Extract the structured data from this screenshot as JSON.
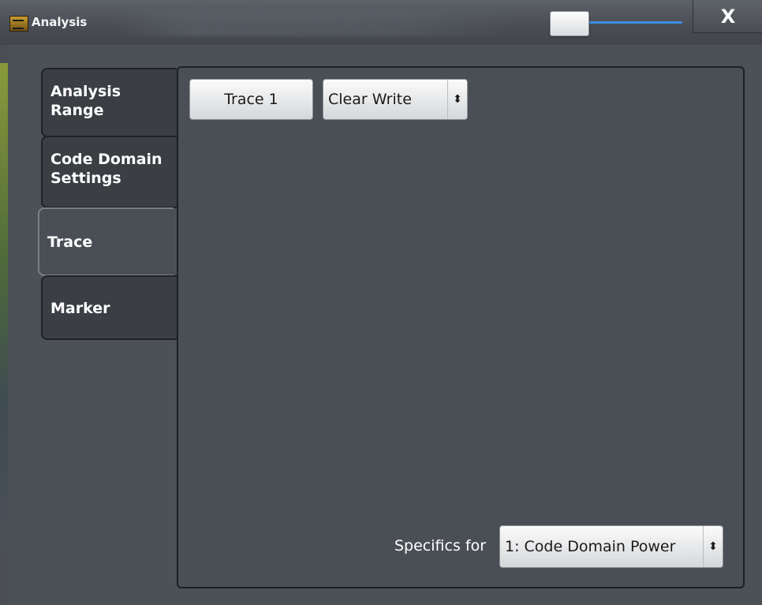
{
  "window": {
    "title": "Analysis",
    "close_label": "X"
  },
  "tabs": [
    {
      "label": "Analysis Range"
    },
    {
      "label": "Code Domain Settings"
    },
    {
      "label": "Trace"
    },
    {
      "label": "Marker"
    }
  ],
  "active_tab": "Trace",
  "trace": {
    "trace_button_label": "Trace 1",
    "mode_value": "Clear Write",
    "specifics_label": "Specifics for",
    "specifics_value": "1: Code Domain Power"
  },
  "icons": {
    "app": "analysis-app-icon",
    "close": "close-icon",
    "updown": "updown-arrows-icon"
  }
}
